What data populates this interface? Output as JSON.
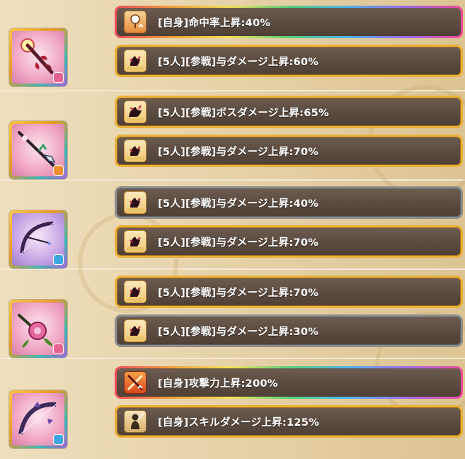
{
  "weapons": [
    {
      "icon": "heart-scepter-weapon-icon",
      "element_icon": "heart-element-icon",
      "element_color": "#e8638f",
      "skills": [
        {
          "icon": "accuracy-up-icon",
          "frame": "rainbow",
          "text": "[自身]命中率上昇:40%"
        },
        {
          "icon": "damage-up-icon",
          "frame": "gold",
          "text": "[5人][参戦]与ダメージ上昇:60%"
        }
      ]
    },
    {
      "icon": "spear-weapon-icon",
      "element_icon": "fire-element-icon",
      "element_color": "#f0902e",
      "skills": [
        {
          "icon": "boss-damage-up-icon",
          "frame": "gold",
          "text": "[5人][参戦]ボスダメージ上昇:65%"
        },
        {
          "icon": "damage-up-icon",
          "frame": "gold",
          "text": "[5人][参戦]与ダメージ上昇:70%"
        }
      ]
    },
    {
      "icon": "bow-weapon-icon",
      "element_icon": "water-element-icon",
      "element_color": "#3fa6e6",
      "skills": [
        {
          "icon": "damage-up-icon",
          "frame": "silver",
          "text": "[5人][参戦]与ダメージ上昇:40%"
        },
        {
          "icon": "damage-up-icon",
          "frame": "gold",
          "text": "[5人][参戦]与ダメージ上昇:70%"
        }
      ]
    },
    {
      "icon": "flower-weapon-icon",
      "element_icon": "heart-element-icon",
      "element_color": "#e8638f",
      "skills": [
        {
          "icon": "damage-up-icon",
          "frame": "gold",
          "text": "[5人][参戦]与ダメージ上昇:70%"
        },
        {
          "icon": "damage-up-icon",
          "frame": "silver",
          "text": "[5人][参戦]与ダメージ上昇:30%"
        }
      ]
    },
    {
      "icon": "dark-bow-weapon-icon",
      "element_icon": "water-element-icon",
      "element_color": "#3fa6e6",
      "skills": [
        {
          "icon": "attack-up-icon",
          "frame": "rainbow",
          "text": "[自身]攻撃力上昇:200%"
        },
        {
          "icon": "skill-damage-up-icon",
          "frame": "gold",
          "text": "[自身]スキルダメージ上昇:125%"
        }
      ]
    }
  ]
}
